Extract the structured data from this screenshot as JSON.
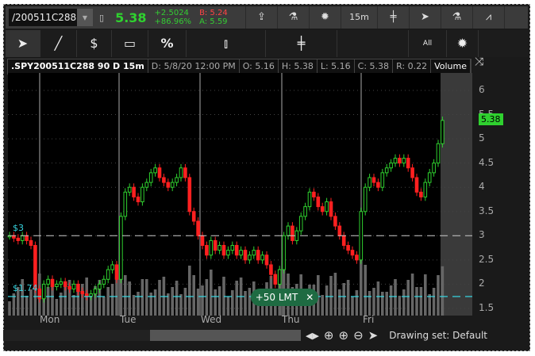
{
  "toolbar": {
    "symbol": "/200511C288",
    "last": "5.38",
    "change": "+2.5024",
    "change_pct": "+86.96%",
    "bid": "B: 5.24",
    "ask": "A: 5.59",
    "timeframe": "15m"
  },
  "drawing_tools": {
    "all_label": "All"
  },
  "info": {
    "symbol": ".SPY200511C288 90 D 15m",
    "date": "D: 5/8/20 12:00 PM",
    "open": "O: 5.16",
    "high": "H: 5.38",
    "low": "L: 5.16",
    "close": "C: 5.38",
    "range": "R: 0.22",
    "volume": "Volume"
  },
  "price_labels": {
    "level3": "$3",
    "level174": "$1.74",
    "current": "5.38"
  },
  "order": {
    "label": "+50 LMT",
    "close": "✕"
  },
  "bottom": {
    "drawing_set": "Drawing set: Default"
  },
  "colors": {
    "up": "#2fd12f",
    "down": "#ff2020",
    "level": "#36d5e0",
    "order": "#1e6b42"
  },
  "chart_data": {
    "type": "candlestick",
    "x_labels": [
      "Mon",
      "Tue",
      "Wed",
      "Thu",
      "Fri"
    ],
    "y_ticks": [
      "6",
      "5.5",
      "5",
      "4.5",
      "4",
      "3.5",
      "3",
      "2.5",
      "2",
      "1.5"
    ],
    "ylim": [
      1.5,
      6
    ],
    "levels": [
      3,
      1.74
    ],
    "closes": [
      3.0,
      2.95,
      2.9,
      3.0,
      2.9,
      2.8,
      1.9,
      1.7,
      2.0,
      2.1,
      1.95,
      2.0,
      2.05,
      1.95,
      1.9,
      2.0,
      1.85,
      1.8,
      1.75,
      1.8,
      1.9,
      2.0,
      2.1,
      2.3,
      2.4,
      2.1,
      3.4,
      3.9,
      4.0,
      3.8,
      3.7,
      4.0,
      4.1,
      4.3,
      4.4,
      4.2,
      4.1,
      4.0,
      4.1,
      4.2,
      4.4,
      4.2,
      3.5,
      3.3,
      3.0,
      2.8,
      2.6,
      2.9,
      2.7,
      2.8,
      2.6,
      2.7,
      2.8,
      2.6,
      2.7,
      2.5,
      2.6,
      2.7,
      2.5,
      2.6,
      2.4,
      2.2,
      2.0,
      2.3,
      3.0,
      3.2,
      2.9,
      3.1,
      3.4,
      3.6,
      3.9,
      3.8,
      3.6,
      3.5,
      3.7,
      3.4,
      3.2,
      3.0,
      2.8,
      2.7,
      2.6,
      2.5,
      3.5,
      4.0,
      4.2,
      4.1,
      4.0,
      4.3,
      4.4,
      4.5,
      4.6,
      4.5,
      4.6,
      4.4,
      4.2,
      3.9,
      3.8,
      4.1,
      4.3,
      4.5,
      4.9,
      5.38
    ]
  }
}
